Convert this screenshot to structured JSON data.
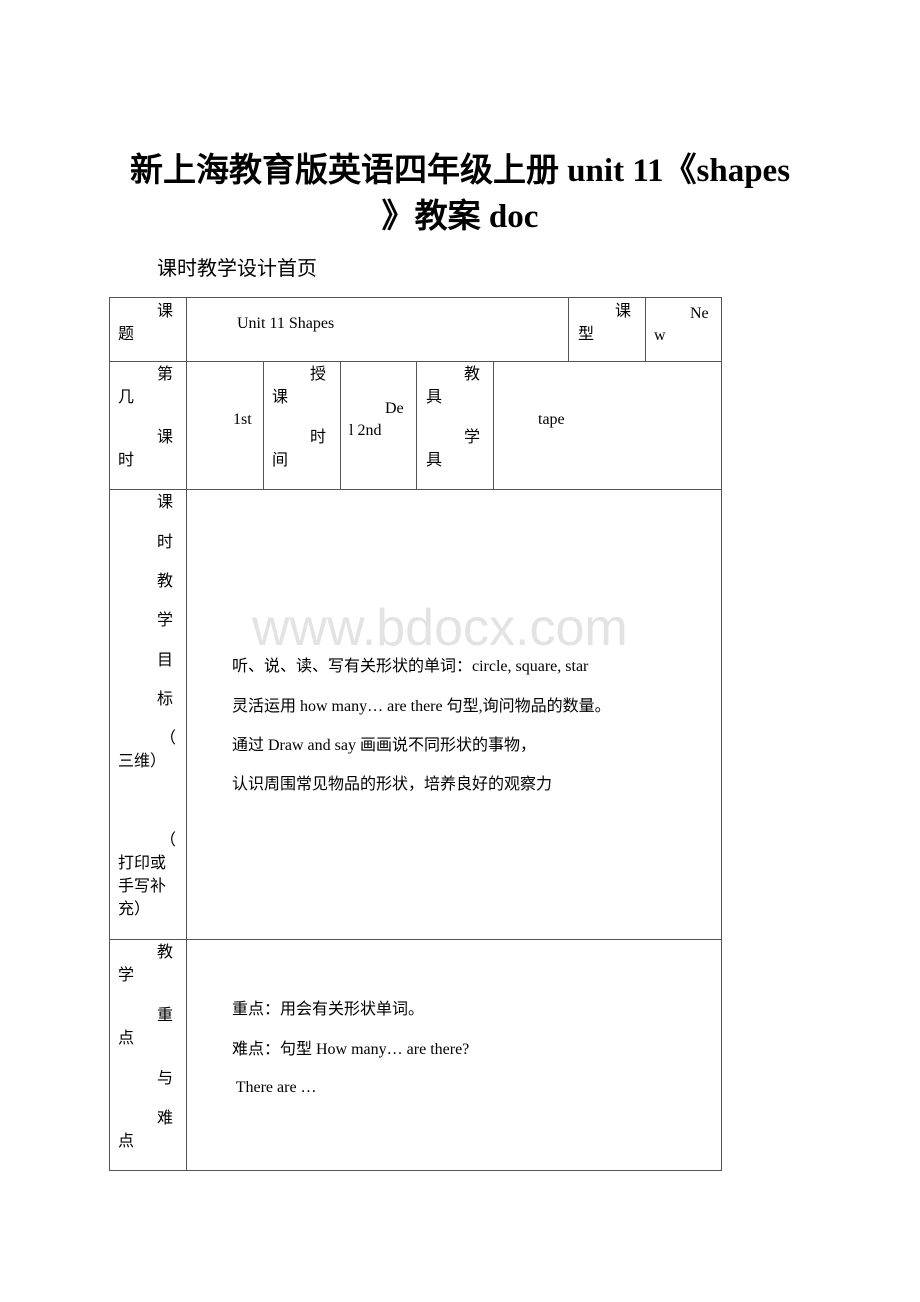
{
  "document": {
    "title_line1": "新上海教育版英语四年级上册 unit 11《shapes",
    "title_line2": "》教案 doc",
    "subtitle": "课时教学设计首页",
    "watermark": "www.bdocx.com"
  },
  "table": {
    "row1": {
      "label_a": "课",
      "label_b": "题",
      "topic": "Unit 11 Shapes",
      "type_label_a": "课",
      "type_label_b": "型",
      "type_value_a": "Ne",
      "type_value_b": "w"
    },
    "row2": {
      "lesson_label": [
        "第",
        "几",
        "课",
        "时"
      ],
      "lesson_value": "1st",
      "time_label": [
        "授",
        "课",
        "时",
        "间"
      ],
      "time_value_a": "De",
      "time_value_b": "l 2nd",
      "tools_label": [
        "教",
        "具",
        "学",
        "具"
      ],
      "tools_value": "tape"
    },
    "row3": {
      "label_chars": [
        "课",
        "时",
        "教",
        "学",
        "目",
        "标"
      ],
      "label_paren1_open": "（",
      "label_paren1_text": "三维）",
      "label_paren2_open": "（",
      "label_paren2_lines": [
        "打印或",
        "手写补",
        "充）"
      ],
      "objectives": [
        "听、说、读、写有关形状的单词：circle, square, star",
        "灵活运用 how many… are there 句型,询问物品的数量。",
        "通过 Draw and say 画画说不同形状的事物，",
        "认识周围常见物品的形状，培养良好的观察力"
      ]
    },
    "row4": {
      "label_chars": [
        "教",
        "学",
        "重",
        "点",
        "与",
        "难",
        "点"
      ],
      "points": [
        "重点：用会有关形状单词。",
        "难点：句型 How many… are there?",
        " There are …"
      ]
    }
  }
}
